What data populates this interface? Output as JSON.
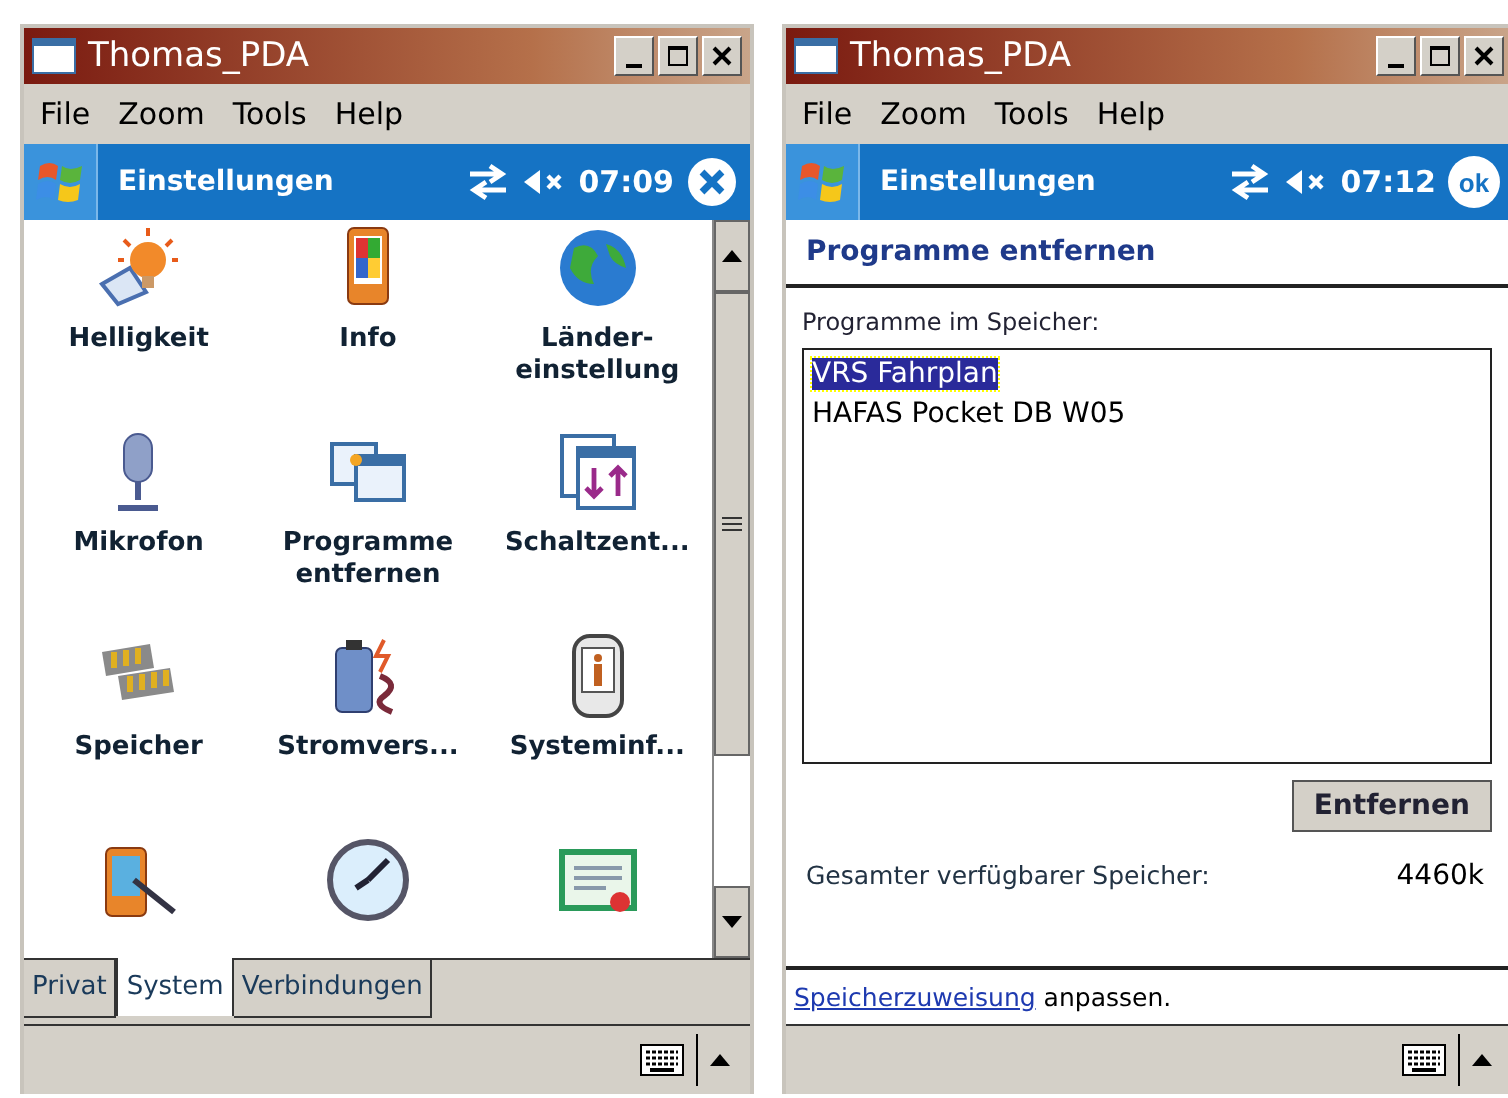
{
  "windows": [
    {
      "kind": "settings_grid",
      "title": "Thomas_PDA",
      "menu": [
        "File",
        "Zoom",
        "Tools",
        "Help"
      ],
      "nav": {
        "title": "Einstellungen",
        "time": "07:09",
        "action": {
          "kind": "close"
        }
      },
      "items": [
        {
          "kind": "labeled",
          "label": "Helligkeit"
        },
        {
          "kind": "labeled",
          "label": "Info"
        },
        {
          "kind": "labeled",
          "label": "Länder-einstellung"
        },
        {
          "kind": "labeled",
          "label": "Mikrofon"
        },
        {
          "kind": "labeled",
          "label": "Programme entfernen"
        },
        {
          "kind": "labeled",
          "label": "Schaltzent..."
        },
        {
          "kind": "labeled",
          "label": "Speicher"
        },
        {
          "kind": "labeled",
          "label": "Stromvers..."
        },
        {
          "kind": "labeled",
          "label": "Systeminf..."
        },
        {
          "kind": "icon_only"
        },
        {
          "kind": "icon_only"
        },
        {
          "kind": "icon_only"
        }
      ],
      "tabs": [
        {
          "label": "Privat",
          "selected": false
        },
        {
          "label": "System",
          "selected": true
        },
        {
          "label": "Verbindungen",
          "selected": false
        }
      ]
    },
    {
      "kind": "remove_programs",
      "title": "Thomas_PDA",
      "menu": [
        "File",
        "Zoom",
        "Tools",
        "Help"
      ],
      "nav": {
        "title": "Einstellungen",
        "time": "07:12",
        "action": {
          "kind": "ok",
          "label": "ok"
        }
      },
      "heading": "Programme entfernen",
      "list_label": "Programme im Speicher:",
      "programs": [
        {
          "name": "VRS Fahrplan",
          "selected": true
        },
        {
          "name": "HAFAS Pocket DB W05",
          "selected": false
        }
      ],
      "button": "Entfernen",
      "memory_label": "Gesamter verfügbarer Speicher:",
      "memory_value": "4460k",
      "footer": {
        "link": "Speicherzuweisung",
        "text": "anpassen."
      }
    }
  ]
}
